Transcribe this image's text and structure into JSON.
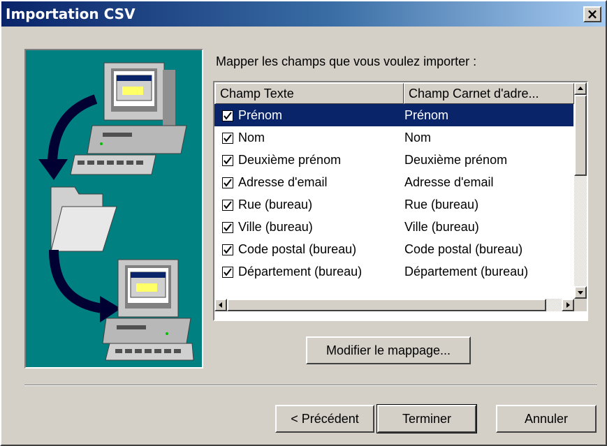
{
  "window": {
    "title": "Importation CSV",
    "close_label": "×"
  },
  "main": {
    "label": "Mapper les champs que vous voulez importer :",
    "columns": [
      "Champ Texte",
      "Champ Carnet d'adre..."
    ],
    "rows": [
      {
        "checked": true,
        "text_field": "Prénom",
        "book_field": "Prénom",
        "selected": true
      },
      {
        "checked": true,
        "text_field": "Nom",
        "book_field": "Nom"
      },
      {
        "checked": true,
        "text_field": "Deuxième prénom",
        "book_field": "Deuxième prénom"
      },
      {
        "checked": true,
        "text_field": "Adresse d'email",
        "book_field": "Adresse d'email"
      },
      {
        "checked": true,
        "text_field": "Rue (bureau)",
        "book_field": "Rue (bureau)"
      },
      {
        "checked": true,
        "text_field": "Ville (bureau)",
        "book_field": "Ville (bureau)"
      },
      {
        "checked": true,
        "text_field": "Code postal (bureau)",
        "book_field": "Code postal (bureau)"
      },
      {
        "checked": true,
        "text_field": "Département (bureau)",
        "book_field": "Département (bureau)"
      }
    ],
    "modify_button": "Modifier le mappage..."
  },
  "footer": {
    "back_button": "< Précédent",
    "finish_button": "Terminer",
    "cancel_button": "Annuler"
  },
  "colors": {
    "titlebar_start": "#0a246a",
    "art_bg": "#008080",
    "dialog_bg": "#d4d0c8",
    "selection": "#0a246a"
  }
}
